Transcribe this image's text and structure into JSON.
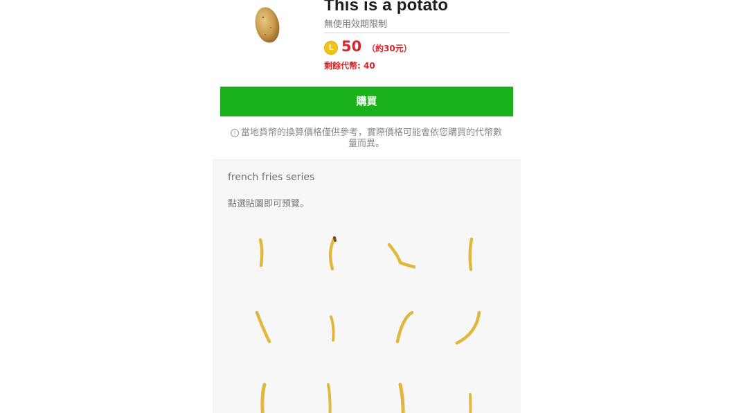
{
  "product": {
    "title": "This is a potato",
    "validity": "無使用效期限制",
    "coin_letter": "L",
    "price": "50",
    "price_note": "（約30元）",
    "remaining": "剩餘代幣: 40"
  },
  "buy_button_label": "購買",
  "notice": {
    "icon": "ⓘ",
    "text": "當地貨幣的換算價格僅供參考，實際價格可能會依您購買的代幣數量而異。"
  },
  "series": {
    "title": "french fries series",
    "hint": "點選貼圖即可預覽。"
  },
  "colors": {
    "buy_green": "#1ab21a",
    "price_red": "#d9262a",
    "coin_gold": "#f2c21b",
    "fry_yellow": "#e8c24a"
  }
}
